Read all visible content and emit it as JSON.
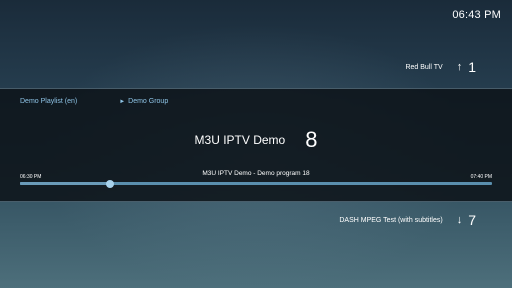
{
  "clock": "06:43 PM",
  "prev_channel": {
    "name": "Red Bull TV",
    "arrow": "↑",
    "number": "1"
  },
  "next_channel": {
    "name": "DASH MPEG Test (with subtitles)",
    "arrow": "↓",
    "number": "7"
  },
  "current": {
    "playlist": "Demo Playlist (en)",
    "group_marker": "►",
    "group": "Demo Group",
    "channel_name": "M3U IPTV Demo",
    "channel_number": "8",
    "program": {
      "title": "M3U IPTV Demo - Demo program 18",
      "start": "06:30 PM",
      "end": "07:40 PM",
      "progress": 0.19
    }
  },
  "colors": {
    "accent": "#8ec4e6",
    "progress_track": "#5a8fae",
    "progress_knob": "#a8d2ec"
  }
}
